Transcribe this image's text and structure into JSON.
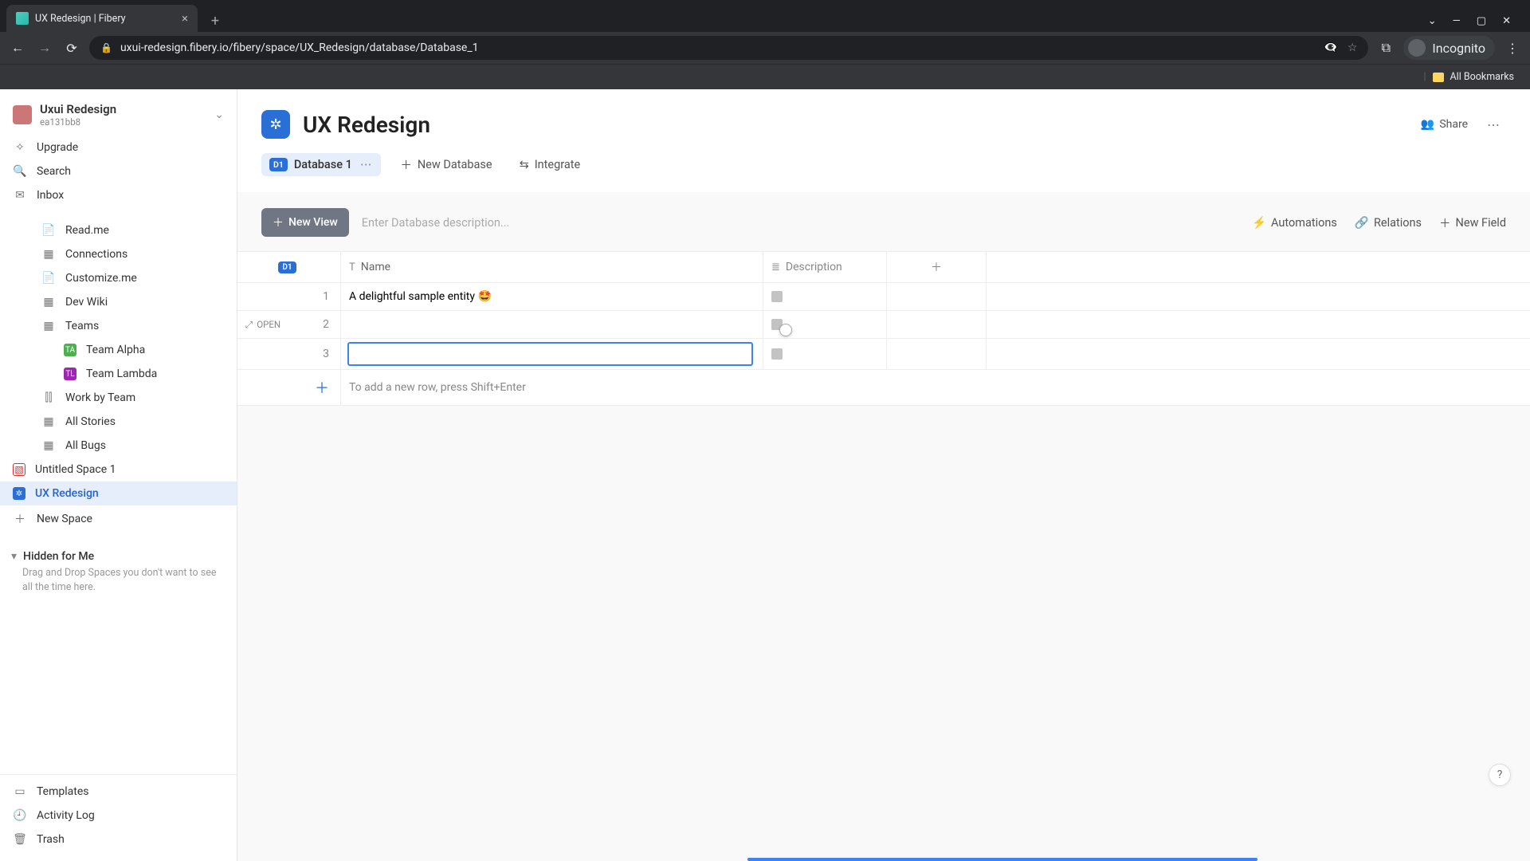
{
  "browser": {
    "tab_title": "UX Redesign | Fibery",
    "url": "uxui-redesign.fibery.io/fibery/space/UX_Redesign/database/Database_1",
    "incognito_label": "Incognito",
    "all_bookmarks": "All Bookmarks"
  },
  "workspace": {
    "name": "Uxui Redesign",
    "id": "ea131bb8"
  },
  "sidebar": {
    "upgrade": "Upgrade",
    "search": "Search",
    "inbox": "Inbox",
    "items": [
      {
        "label": "Read.me",
        "icon": "doc"
      },
      {
        "label": "Connections",
        "icon": "grid"
      },
      {
        "label": "Customize.me",
        "icon": "doc"
      },
      {
        "label": "Dev Wiki",
        "icon": "grid"
      },
      {
        "label": "Teams",
        "icon": "grid"
      }
    ],
    "teams": [
      {
        "label": "Team Alpha",
        "initials": "TA",
        "color": "green"
      },
      {
        "label": "Team Lambda",
        "initials": "TL",
        "color": "purple"
      }
    ],
    "more": [
      {
        "label": "Work by Team"
      },
      {
        "label": "All Stories"
      },
      {
        "label": "All Bugs"
      }
    ],
    "spaces": [
      {
        "label": "Untitled Space 1",
        "icon_kind": "red-strike"
      },
      {
        "label": "UX Redesign",
        "icon_kind": "blue",
        "selected": true
      }
    ],
    "new_space": "New Space",
    "hidden_header": "Hidden for Me",
    "hidden_hint": "Drag and Drop Spaces you don't want to see all the time here.",
    "bottom": {
      "templates": "Templates",
      "activity_log": "Activity Log",
      "trash": "Trash"
    }
  },
  "header": {
    "title": "UX Redesign",
    "share": "Share"
  },
  "db_tabs": {
    "badge": "D1",
    "label": "Database 1",
    "new_db": "New Database",
    "integrate": "Integrate"
  },
  "view_strip": {
    "new_view": "New View",
    "desc_placeholder": "Enter Database description...",
    "automations": "Automations",
    "relations": "Relations",
    "new_field": "New Field"
  },
  "grid": {
    "header_badge": "D1",
    "col_name": "Name",
    "col_desc": "Description",
    "rows": [
      {
        "n": "1",
        "name": "A delightful sample entity 🤩"
      },
      {
        "n": "2",
        "name": "",
        "open": true
      },
      {
        "n": "3",
        "name": "",
        "editing": true
      }
    ],
    "open_label": "OPEN",
    "add_row_hint": "To add a new row, press Shift+Enter"
  },
  "help": "?"
}
